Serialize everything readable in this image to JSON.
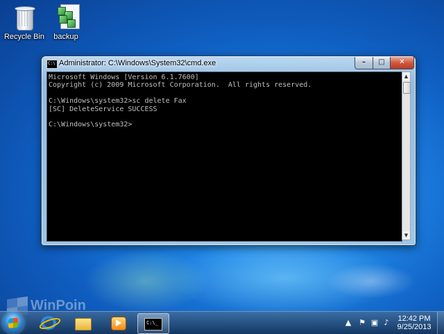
{
  "desktop": {
    "icons": [
      {
        "label": "Recycle Bin",
        "icon": "recycle-bin-icon"
      },
      {
        "label": "backup",
        "icon": "script-file-icon"
      }
    ]
  },
  "window": {
    "title": "Administrator: C:\\Windows\\System32\\cmd.exe",
    "icon_text": "C:\\",
    "console_text": "Microsoft Windows [Version 6.1.7600]\nCopyright (c) 2009 Microsoft Corporation.  All rights reserved.\n\nC:\\Windows\\system32>sc delete Fax\n[SC] DeleteService SUCCESS\n\nC:\\Windows\\system32>",
    "controls": {
      "minimize": "–",
      "maximize": "□",
      "close": "✕"
    },
    "console_bg": "#000000",
    "console_fg": "#c0c0c0"
  },
  "taskbar": {
    "items": [
      "start-orb",
      "internet-explorer-icon",
      "windows-explorer-icon",
      "media-player-icon",
      "command-prompt-icon"
    ],
    "active": "command-prompt-icon",
    "cmd_icon_text": "C:\\_",
    "tray": {
      "arrow": "▲",
      "flag": "⚑",
      "network": "▣",
      "volume": "♪",
      "time": "12:42 PM",
      "date": "9/25/2013"
    }
  },
  "watermark": {
    "text": "WinPoin"
  }
}
